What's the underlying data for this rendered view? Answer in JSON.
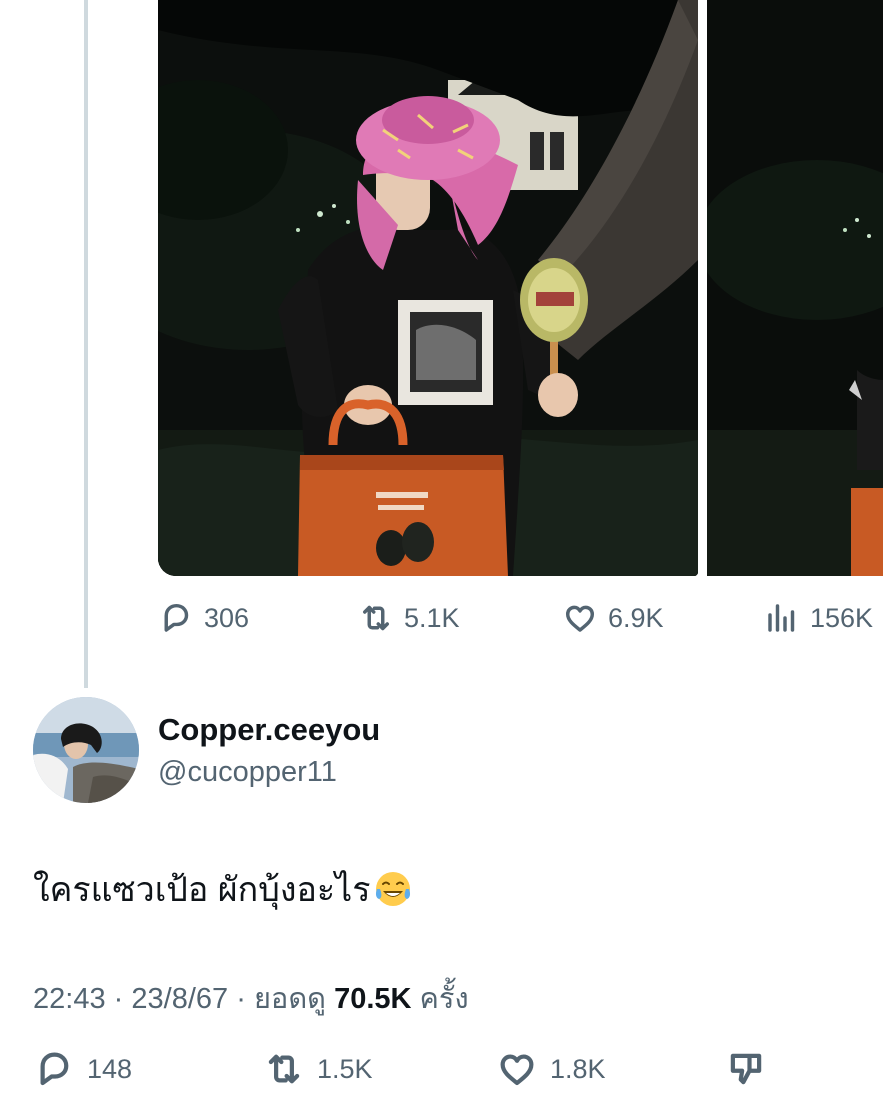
{
  "quoted_post": {
    "stats": {
      "replies": "306",
      "reposts": "5.1K",
      "likes": "6.9K",
      "views": "156K"
    }
  },
  "reply": {
    "author": {
      "display_name": "Copper.ceeyou",
      "handle": "@cucopper11"
    },
    "text": "ใครแซวเป้อ ผักบุ้งอะไร",
    "emoji": "face-with-tears-of-joy",
    "time": "22:43",
    "date": "23/8/67",
    "views_prefix": "ยอดดู",
    "views_count": "70.5K",
    "views_suffix": "ครั้ง",
    "separator": "·",
    "actions": {
      "replies": "148",
      "reposts": "1.5K",
      "likes": "1.8K"
    }
  },
  "icons": [
    "reply-icon",
    "repost-icon",
    "like-icon",
    "views-icon",
    "dislike-icon"
  ],
  "colors": {
    "text": "#0f1419",
    "secondary": "#536471",
    "thread_line": "#cfd9de"
  }
}
